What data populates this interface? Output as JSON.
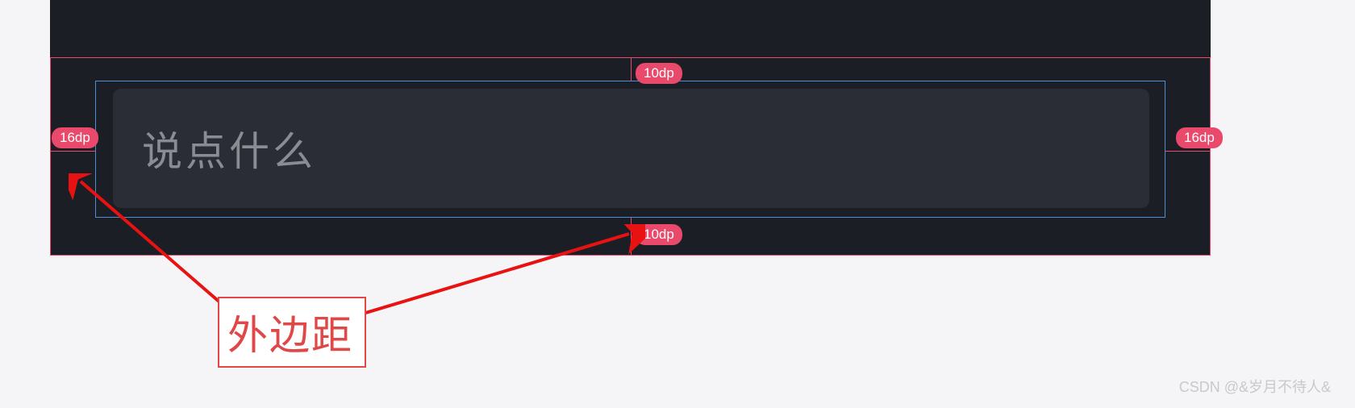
{
  "input": {
    "placeholder": "说点什么"
  },
  "margins": {
    "top": "10dp",
    "bottom": "10dp",
    "left": "16dp",
    "right": "16dp"
  },
  "annotation": {
    "label": "外边距"
  },
  "watermark": "CSDN @&岁月不待人&"
}
